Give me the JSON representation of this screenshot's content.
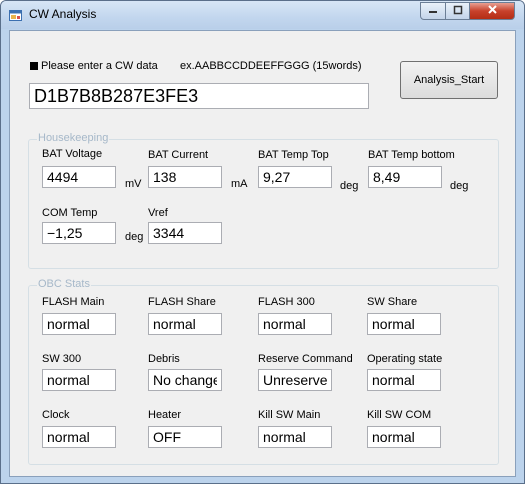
{
  "window": {
    "title": "CW Analysis"
  },
  "input_section": {
    "instruction": "Please enter a CW data",
    "example": "ex.AABBCCDDEEFFGGG (15words)",
    "cw_value": "D1B7B8B287E3FE3",
    "start_button": "Analysis_Start"
  },
  "housekeeping": {
    "title": "Housekeeping",
    "fields": [
      {
        "label": "BAT Voltage",
        "value": "4494",
        "unit": "mV"
      },
      {
        "label": "BAT Current",
        "value": "138",
        "unit": "mA"
      },
      {
        "label": "BAT Temp Top",
        "value": "9,27",
        "unit": "deg"
      },
      {
        "label": "BAT Temp bottom",
        "value": "8,49",
        "unit": "deg"
      },
      {
        "label": "COM Temp",
        "value": "−1,25",
        "unit": "deg"
      },
      {
        "label": "Vref",
        "value": "3344",
        "unit": ""
      }
    ]
  },
  "obc_stats": {
    "title": "OBC Stats",
    "fields": [
      {
        "label": "FLASH Main",
        "value": "normal"
      },
      {
        "label": "FLASH Share",
        "value": "normal"
      },
      {
        "label": "FLASH 300",
        "value": "normal"
      },
      {
        "label": "SW Share",
        "value": "normal"
      },
      {
        "label": "SW 300",
        "value": "normal"
      },
      {
        "label": "Debris",
        "value": "No change"
      },
      {
        "label": "Reserve Command",
        "value": "Unreserve"
      },
      {
        "label": "Operating state",
        "value": "normal"
      },
      {
        "label": "Clock",
        "value": "normal"
      },
      {
        "label": "Heater",
        "value": "OFF"
      },
      {
        "label": "Kill SW Main",
        "value": "normal"
      },
      {
        "label": "Kill SW COM",
        "value": "normal"
      }
    ]
  },
  "icons": {
    "app": "app-window-icon",
    "minimize": "minimize-icon",
    "maximize": "maximize-icon",
    "close": "close-icon"
  }
}
